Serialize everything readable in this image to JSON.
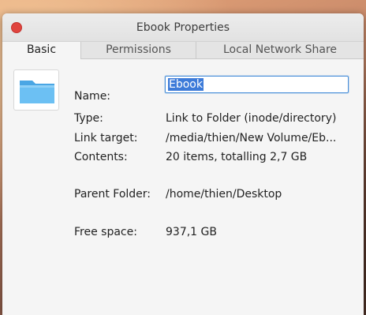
{
  "window": {
    "title": "Ebook Properties"
  },
  "tabs": [
    {
      "label": "Basic",
      "active": true
    },
    {
      "label": "Permissions",
      "active": false
    },
    {
      "label": "Local Network Share",
      "active": false
    }
  ],
  "icon": "folder-icon",
  "colors": {
    "folder": "#5ab4ee",
    "selection": "#3d7bd9",
    "close_button": "#e0443e"
  },
  "fields": {
    "name_label": "Name:",
    "name_value": "Ebook",
    "type_label": "Type:",
    "type_value": "Link to Folder (inode/directory)",
    "link_label": "Link target:",
    "link_value": "/media/thien/New Volume/Eb...",
    "contents_label": "Contents:",
    "contents_value": "20 items, totalling 2,7 GB",
    "parent_label": "Parent Folder:",
    "parent_value": "/home/thien/Desktop",
    "free_label": "Free space:",
    "free_value": "937,1 GB"
  }
}
